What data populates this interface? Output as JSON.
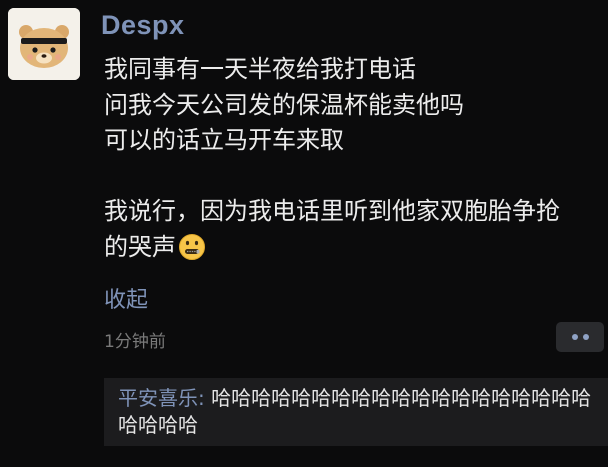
{
  "post": {
    "author": "Despx",
    "lines": [
      "我同事有一天半夜给我打电话",
      "问我今天公司发的保温杯能卖他吗",
      "可以的话立马开车来取",
      "",
      "我说行，因为我电话里听到他家双胞胎争抢",
      "的哭声"
    ],
    "emoji": "zipper-mouth-face",
    "collapse_label": "收起",
    "timestamp": "1分钟前"
  },
  "comments": [
    {
      "author": "平安喜乐",
      "separator": ": ",
      "text": "哈哈哈哈哈哈哈哈哈哈哈哈哈哈哈哈哈哈哈哈哈哈哈"
    }
  ],
  "colors": {
    "background": "#0b0b0c",
    "accent_link": "#7f93b8",
    "comment_box": "#1c1c1e"
  }
}
